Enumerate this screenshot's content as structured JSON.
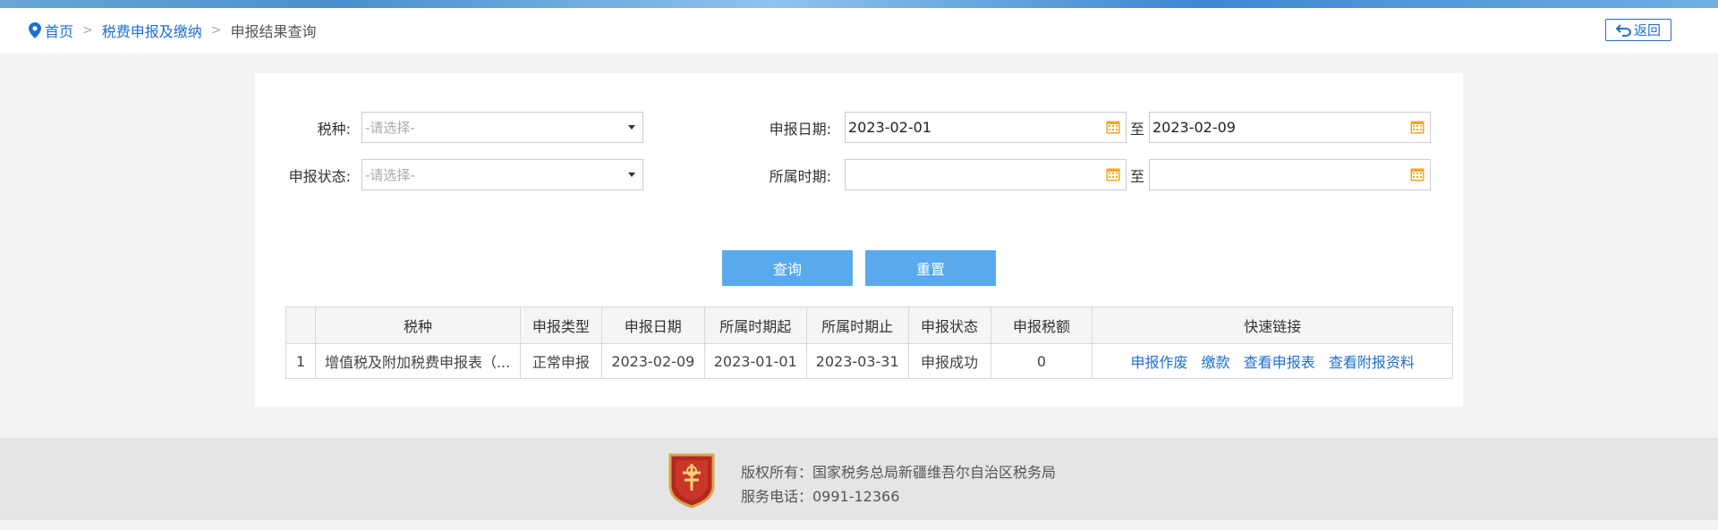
{
  "breadcrumb": {
    "home": "首页",
    "level2": "税费申报及缴纳",
    "current": "申报结果查询",
    "sep": ">"
  },
  "back_button": {
    "label": "返回"
  },
  "filters": {
    "tax_type_label": "税种:",
    "tax_type_placeholder": "-请选择-",
    "status_label": "申报状态:",
    "status_placeholder": "-请选择-",
    "decl_date_label": "申报日期:",
    "decl_date_from": "2023-02-01",
    "decl_date_to": "2023-02-09",
    "period_label": "所属时期:",
    "period_from": "",
    "period_to": "",
    "to_text": "至"
  },
  "actions": {
    "query": "查询",
    "reset": "重置"
  },
  "table": {
    "headers": [
      "",
      "税种",
      "申报类型",
      "申报日期",
      "所属时期起",
      "所属时期止",
      "申报状态",
      "申报税额",
      "快速链接"
    ],
    "rows": [
      {
        "index": "1",
        "tax_type": "增值税及附加税费申报表（...",
        "decl_type": "正常申报",
        "decl_date": "2023-02-09",
        "period_start": "2023-01-01",
        "period_end": "2023-03-31",
        "status": "申报成功",
        "amount": "0",
        "links": [
          "申报作废",
          "缴款",
          "查看申报表",
          "查看附报资料"
        ]
      }
    ]
  },
  "footer": {
    "copyright": "版权所有：国家税务总局新疆维吾尔自治区税务局",
    "phone": "服务电话：0991-12366"
  },
  "colors": {
    "link": "#1f6fd1",
    "button": "#58a9ee",
    "calendar_icon": "#f5a623",
    "footer_bg": "#e4e5e7"
  }
}
